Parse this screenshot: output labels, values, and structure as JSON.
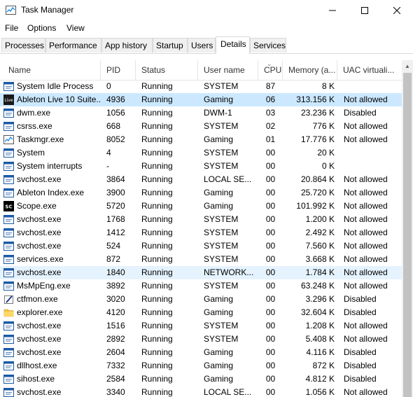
{
  "window": {
    "title": "Task Manager"
  },
  "menu": [
    "File",
    "Options",
    "View"
  ],
  "tabs": [
    {
      "label": "Processes"
    },
    {
      "label": "Performance"
    },
    {
      "label": "App history"
    },
    {
      "label": "Startup"
    },
    {
      "label": "Users"
    },
    {
      "label": "Details"
    },
    {
      "label": "Services"
    }
  ],
  "active_tab": "Details",
  "columns": [
    "Name",
    "PID",
    "Status",
    "User name",
    "CPU",
    "Memory (a...",
    "UAC virtuali..."
  ],
  "rows": [
    {
      "name": "System Idle Process",
      "pid": "0",
      "status": "Running",
      "user": "SYSTEM",
      "cpu": "87",
      "mem": "8 K",
      "uac": "",
      "icon": "generic-process-icon"
    },
    {
      "name": "Ableton Live 10 Suite...",
      "pid": "4936",
      "status": "Running",
      "user": "Gaming",
      "cpu": "06",
      "mem": "313.156 K",
      "uac": "Not allowed",
      "icon": "ableton-live-icon"
    },
    {
      "name": "dwm.exe",
      "pid": "1056",
      "status": "Running",
      "user": "DWM-1",
      "cpu": "03",
      "mem": "23.236 K",
      "uac": "Disabled",
      "icon": "generic-process-icon"
    },
    {
      "name": "csrss.exe",
      "pid": "668",
      "status": "Running",
      "user": "SYSTEM",
      "cpu": "02",
      "mem": "776 K",
      "uac": "Not allowed",
      "icon": "generic-process-icon"
    },
    {
      "name": "Taskmgr.exe",
      "pid": "8052",
      "status": "Running",
      "user": "Gaming",
      "cpu": "01",
      "mem": "17.776 K",
      "uac": "Not allowed",
      "icon": "task-manager-icon"
    },
    {
      "name": "System",
      "pid": "4",
      "status": "Running",
      "user": "SYSTEM",
      "cpu": "00",
      "mem": "20 K",
      "uac": "",
      "icon": "generic-process-icon"
    },
    {
      "name": "System interrupts",
      "pid": "-",
      "status": "Running",
      "user": "SYSTEM",
      "cpu": "00",
      "mem": "0 K",
      "uac": "",
      "icon": "generic-process-icon"
    },
    {
      "name": "svchost.exe",
      "pid": "3864",
      "status": "Running",
      "user": "LOCAL SE...",
      "cpu": "00",
      "mem": "20.864 K",
      "uac": "Not allowed",
      "icon": "generic-process-icon"
    },
    {
      "name": "Ableton Index.exe",
      "pid": "3900",
      "status": "Running",
      "user": "Gaming",
      "cpu": "00",
      "mem": "25.720 K",
      "uac": "Not allowed",
      "icon": "generic-process-icon"
    },
    {
      "name": "Scope.exe",
      "pid": "5720",
      "status": "Running",
      "user": "Gaming",
      "cpu": "00",
      "mem": "101.992 K",
      "uac": "Not allowed",
      "icon": "scope-icon"
    },
    {
      "name": "svchost.exe",
      "pid": "1768",
      "status": "Running",
      "user": "SYSTEM",
      "cpu": "00",
      "mem": "1.200 K",
      "uac": "Not allowed",
      "icon": "generic-process-icon"
    },
    {
      "name": "svchost.exe",
      "pid": "1412",
      "status": "Running",
      "user": "SYSTEM",
      "cpu": "00",
      "mem": "2.492 K",
      "uac": "Not allowed",
      "icon": "generic-process-icon"
    },
    {
      "name": "svchost.exe",
      "pid": "524",
      "status": "Running",
      "user": "SYSTEM",
      "cpu": "00",
      "mem": "7.560 K",
      "uac": "Not allowed",
      "icon": "generic-process-icon"
    },
    {
      "name": "services.exe",
      "pid": "872",
      "status": "Running",
      "user": "SYSTEM",
      "cpu": "00",
      "mem": "3.668 K",
      "uac": "Not allowed",
      "icon": "generic-process-icon"
    },
    {
      "name": "svchost.exe",
      "pid": "1840",
      "status": "Running",
      "user": "NETWORK...",
      "cpu": "00",
      "mem": "1.784 K",
      "uac": "Not allowed",
      "icon": "generic-process-icon"
    },
    {
      "name": "MsMpEng.exe",
      "pid": "3892",
      "status": "Running",
      "user": "SYSTEM",
      "cpu": "00",
      "mem": "63.248 K",
      "uac": "Not allowed",
      "icon": "generic-process-icon"
    },
    {
      "name": "ctfmon.exe",
      "pid": "3020",
      "status": "Running",
      "user": "Gaming",
      "cpu": "00",
      "mem": "3.296 K",
      "uac": "Disabled",
      "icon": "ctfmon-icon"
    },
    {
      "name": "explorer.exe",
      "pid": "4120",
      "status": "Running",
      "user": "Gaming",
      "cpu": "00",
      "mem": "32.604 K",
      "uac": "Disabled",
      "icon": "folder-icon"
    },
    {
      "name": "svchost.exe",
      "pid": "1516",
      "status": "Running",
      "user": "SYSTEM",
      "cpu": "00",
      "mem": "1.208 K",
      "uac": "Not allowed",
      "icon": "generic-process-icon"
    },
    {
      "name": "svchost.exe",
      "pid": "2892",
      "status": "Running",
      "user": "SYSTEM",
      "cpu": "00",
      "mem": "5.408 K",
      "uac": "Not allowed",
      "icon": "generic-process-icon"
    },
    {
      "name": "svchost.exe",
      "pid": "2604",
      "status": "Running",
      "user": "Gaming",
      "cpu": "00",
      "mem": "4.116 K",
      "uac": "Disabled",
      "icon": "generic-process-icon"
    },
    {
      "name": "dllhost.exe",
      "pid": "7332",
      "status": "Running",
      "user": "Gaming",
      "cpu": "00",
      "mem": "872 K",
      "uac": "Disabled",
      "icon": "generic-process-icon"
    },
    {
      "name": "sihost.exe",
      "pid": "2584",
      "status": "Running",
      "user": "Gaming",
      "cpu": "00",
      "mem": "4.812 K",
      "uac": "Disabled",
      "icon": "generic-process-icon"
    },
    {
      "name": "svchost.exe",
      "pid": "3340",
      "status": "Running",
      "user": "LOCAL SE...",
      "cpu": "00",
      "mem": "1.056 K",
      "uac": "Not allowed",
      "icon": "generic-process-icon"
    }
  ],
  "selected_row": 1,
  "hover_row": 14,
  "colors": {
    "selected": "#cce8ff",
    "hover": "#e5f3ff"
  }
}
